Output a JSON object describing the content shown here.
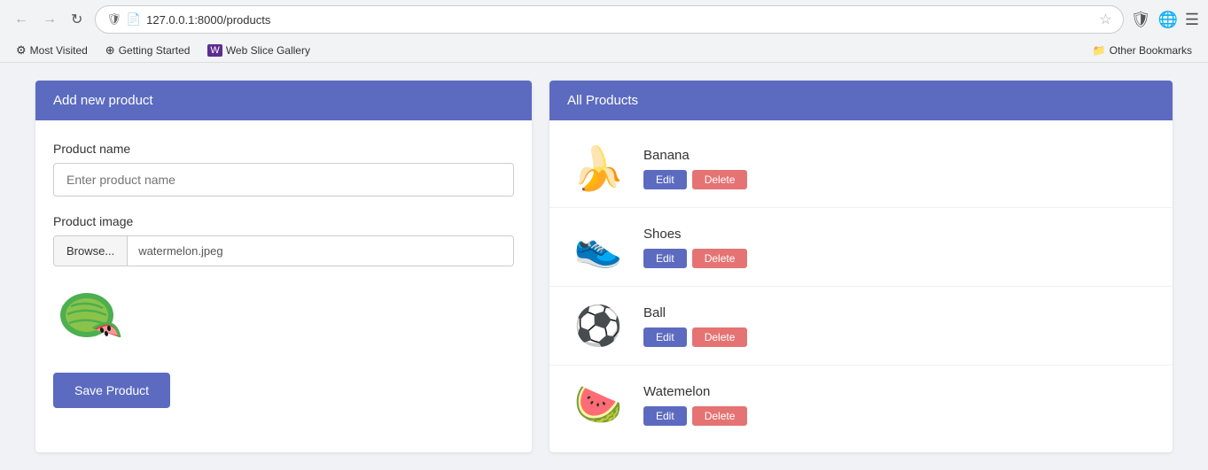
{
  "browser": {
    "url": "127.0.0.1:8000/products",
    "nav": {
      "back_label": "←",
      "forward_label": "→",
      "refresh_label": "↻"
    },
    "bookmarks": [
      {
        "id": "most-visited",
        "icon": "⚙",
        "label": "Most Visited"
      },
      {
        "id": "getting-started",
        "icon": "⊕",
        "label": "Getting Started"
      },
      {
        "id": "web-slice-gallery",
        "icon": "◈",
        "label": "Web Slice Gallery"
      }
    ],
    "other_bookmarks": "Other Bookmarks",
    "right_icons": [
      "🛡",
      "🌐",
      "☰"
    ]
  },
  "left_panel": {
    "header": "Add new product",
    "product_name_label": "Product name",
    "product_name_placeholder": "Enter product name",
    "product_image_label": "Product image",
    "browse_btn_label": "Browse...",
    "file_name": "watermelon.jpeg",
    "save_btn_label": "Save Product"
  },
  "right_panel": {
    "header": "All Products",
    "products": [
      {
        "id": "banana",
        "name": "Banana",
        "emoji": "🍌"
      },
      {
        "id": "shoes",
        "name": "Shoes",
        "emoji": "👟"
      },
      {
        "id": "ball",
        "name": "Ball",
        "emoji": "⚽"
      },
      {
        "id": "watermelon",
        "name": "Watemelon",
        "emoji": "🍉"
      }
    ],
    "edit_label": "Edit",
    "delete_label": "Delete"
  },
  "colors": {
    "panel_header": "#5c6bc0",
    "edit_btn": "#5c6bc0",
    "delete_btn": "#e57373"
  }
}
